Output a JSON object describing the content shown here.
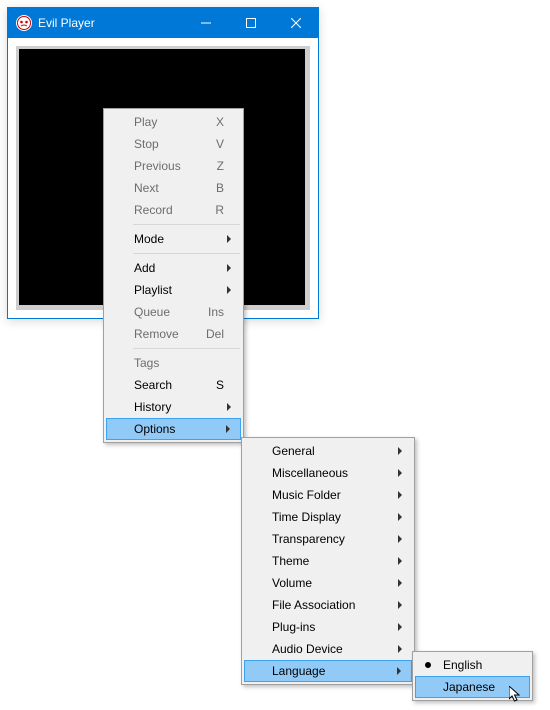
{
  "window": {
    "title": "Evil Player"
  },
  "menu1": [
    {
      "label": "Play",
      "short": "X",
      "disabled": true
    },
    {
      "label": "Stop",
      "short": "V",
      "disabled": true
    },
    {
      "label": "Previous",
      "short": "Z",
      "disabled": true
    },
    {
      "label": "Next",
      "short": "B",
      "disabled": true
    },
    {
      "label": "Record",
      "short": "R",
      "disabled": true
    },
    {
      "sep": true
    },
    {
      "label": "Mode",
      "sub": true
    },
    {
      "sep": true
    },
    {
      "label": "Add",
      "sub": true
    },
    {
      "label": "Playlist",
      "sub": true
    },
    {
      "label": "Queue",
      "short": "Ins",
      "disabled": true
    },
    {
      "label": "Remove",
      "short": "Del",
      "disabled": true
    },
    {
      "sep": true
    },
    {
      "label": "Tags",
      "disabled": true
    },
    {
      "label": "Search",
      "short": "S"
    },
    {
      "label": "History",
      "sub": true
    },
    {
      "label": "Options",
      "sub": true,
      "hover": true
    }
  ],
  "menu2": [
    {
      "label": "General",
      "sub": true
    },
    {
      "label": "Miscellaneous",
      "sub": true
    },
    {
      "label": "Music Folder",
      "sub": true
    },
    {
      "label": "Time Display",
      "sub": true
    },
    {
      "label": "Transparency",
      "sub": true
    },
    {
      "label": "Theme",
      "sub": true
    },
    {
      "label": "Volume",
      "sub": true
    },
    {
      "label": "File Association",
      "sub": true
    },
    {
      "label": "Plug-ins",
      "sub": true
    },
    {
      "label": "Audio Device",
      "sub": true
    },
    {
      "label": "Language",
      "sub": true,
      "hover": true
    }
  ],
  "menu3": [
    {
      "label": "English",
      "radio": true
    },
    {
      "label": "Japanese",
      "hover": true
    }
  ]
}
